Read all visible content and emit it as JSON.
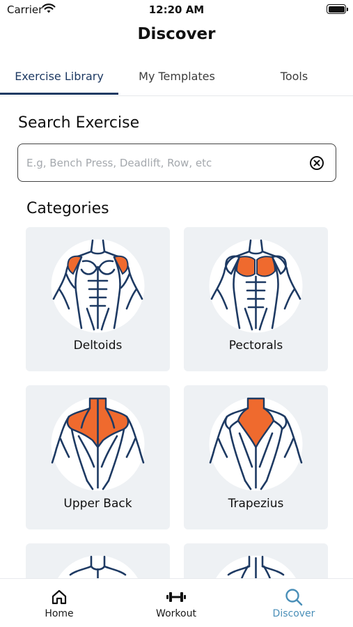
{
  "status_bar": {
    "carrier": "Carrier",
    "time": "12:20 AM"
  },
  "header": {
    "title": "Discover"
  },
  "tabs": [
    {
      "label": "Exercise Library",
      "active": true
    },
    {
      "label": "My Templates",
      "active": false
    },
    {
      "label": "Tools",
      "active": false
    }
  ],
  "search": {
    "title": "Search Exercise",
    "placeholder": "E.g, Bench Press, Deadlift, Row, etc",
    "value": ""
  },
  "categories": {
    "title": "Categories",
    "items": [
      {
        "label": "Deltoids",
        "highlight": "deltoids"
      },
      {
        "label": "Pectorals",
        "highlight": "pectorals"
      },
      {
        "label": "Upper Back",
        "highlight": "upper-back"
      },
      {
        "label": "Trapezius",
        "highlight": "trapezius"
      }
    ]
  },
  "colors": {
    "accent": "#1e3a63",
    "highlight_muscle": "#ef6a2e",
    "active_nav": "#4a8fb8",
    "card_bg": "#eef1f4"
  },
  "bottom_nav": [
    {
      "label": "Home",
      "icon": "home-icon",
      "active": false
    },
    {
      "label": "Workout",
      "icon": "dumbbell-icon",
      "active": false
    },
    {
      "label": "Discover",
      "icon": "search-icon",
      "active": true
    }
  ]
}
